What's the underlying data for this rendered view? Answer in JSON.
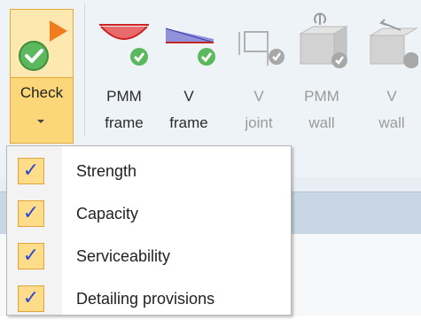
{
  "ribbon": {
    "check": {
      "label": "Check",
      "icon": "check-circle-flag-icon"
    },
    "buttons": [
      {
        "label": "PMM\nframe",
        "line1": "PMM",
        "line2": "frame",
        "enabled": true,
        "icon": "pmm-frame-icon"
      },
      {
        "label": "V\nframe",
        "line1": "V",
        "line2": "frame",
        "enabled": true,
        "icon": "v-frame-icon"
      },
      {
        "label": "V\njoint",
        "line1": "V",
        "line2": "joint",
        "enabled": false,
        "icon": "v-joint-icon"
      },
      {
        "label": "PMM\nwall",
        "line1": "PMM",
        "line2": "wall",
        "enabled": false,
        "icon": "pmm-wall-icon"
      },
      {
        "label": "V\nwall",
        "line1": "V",
        "line2": "wall",
        "enabled": false,
        "icon": "v-wall-icon"
      }
    ]
  },
  "menu": {
    "items": [
      {
        "label": "Strength",
        "checked": true
      },
      {
        "label": "Capacity",
        "checked": true
      },
      {
        "label": "Serviceability",
        "checked": true
      },
      {
        "label": "Detailing provisions",
        "checked": true
      }
    ],
    "check_glyph": "✓"
  },
  "colors": {
    "accent": "#fcd779",
    "accent_border": "#e4a93a",
    "success": "#5cb85c",
    "flag": "#f07c1e",
    "check_mark": "#2a4bd0"
  }
}
